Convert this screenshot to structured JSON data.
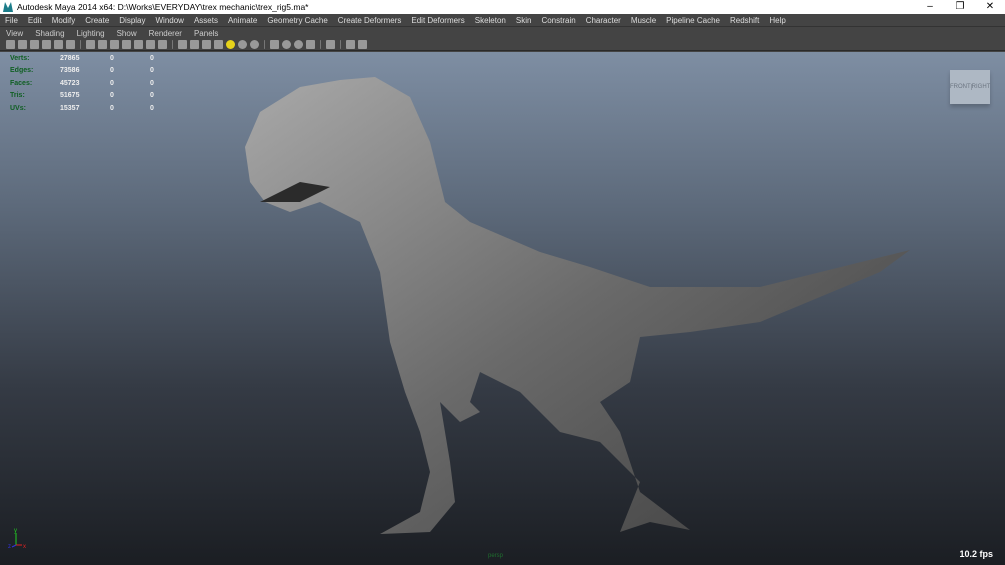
{
  "window": {
    "title": "Autodesk Maya 2014 x64: D:\\Works\\EVERYDAY\\trex mechanic\\trex_rig5.ma*",
    "minimize": "–",
    "restore": "❐",
    "close": "✕"
  },
  "menu": [
    "File",
    "Edit",
    "Modify",
    "Create",
    "Display",
    "Window",
    "Assets",
    "Animate",
    "Geometry Cache",
    "Create Deformers",
    "Edit Deformers",
    "Skeleton",
    "Skin",
    "Constrain",
    "Character",
    "Muscle",
    "Pipeline Cache",
    "Redshift",
    "Help"
  ],
  "panel_menu": [
    "View",
    "Shading",
    "Lighting",
    "Show",
    "Renderer",
    "Panels"
  ],
  "hud": [
    {
      "label": "Verts:",
      "value": "27865",
      "a": "0",
      "b": "0"
    },
    {
      "label": "Edges:",
      "value": "73586",
      "a": "0",
      "b": "0"
    },
    {
      "label": "Faces:",
      "value": "45723",
      "a": "0",
      "b": "0"
    },
    {
      "label": "Tris:",
      "value": "51675",
      "a": "0",
      "b": "0"
    },
    {
      "label": "UVs:",
      "value": "15357",
      "a": "0",
      "b": "0"
    }
  ],
  "viewcube": {
    "front": "FRONT",
    "right": "RIGHT"
  },
  "camera": "persp",
  "fps": "10.2 fps",
  "axis": {
    "y": "y",
    "z": "z",
    "x": "x"
  }
}
